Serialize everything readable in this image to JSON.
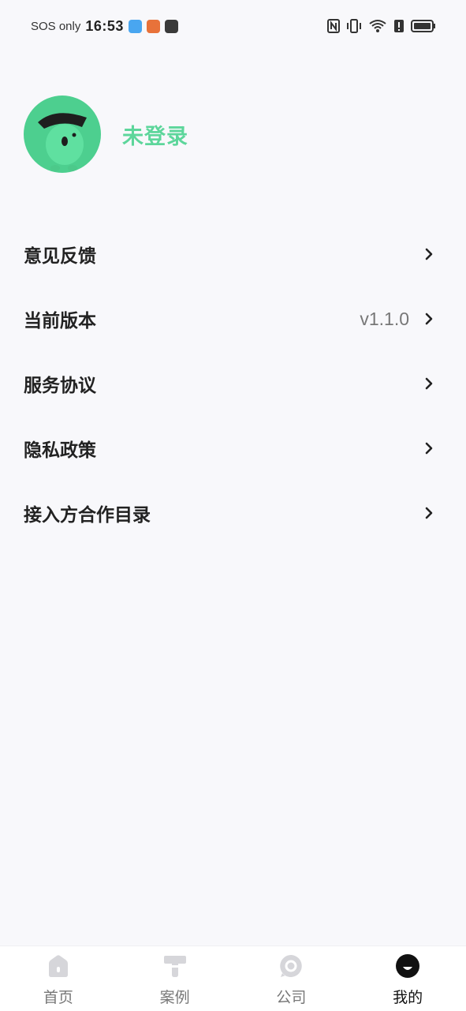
{
  "status_bar": {
    "carrier": "SOS only",
    "time": "16:53"
  },
  "profile": {
    "username": "未登录"
  },
  "menu": {
    "items": [
      {
        "label": "意见反馈",
        "value": ""
      },
      {
        "label": "当前版本",
        "value": "v1.1.0"
      },
      {
        "label": "服务协议",
        "value": ""
      },
      {
        "label": "隐私政策",
        "value": ""
      },
      {
        "label": "接入方合作目录",
        "value": ""
      }
    ]
  },
  "tabbar": {
    "tabs": [
      {
        "label": "首页",
        "icon": "home-icon",
        "active": false
      },
      {
        "label": "案例",
        "icon": "case-icon",
        "active": false
      },
      {
        "label": "公司",
        "icon": "company-icon",
        "active": false
      },
      {
        "label": "我的",
        "icon": "profile-icon",
        "active": true
      }
    ]
  },
  "colors": {
    "accent": "#5dd69b",
    "avatar_bg": "#4dcf8f",
    "background": "#f8f8fb"
  }
}
